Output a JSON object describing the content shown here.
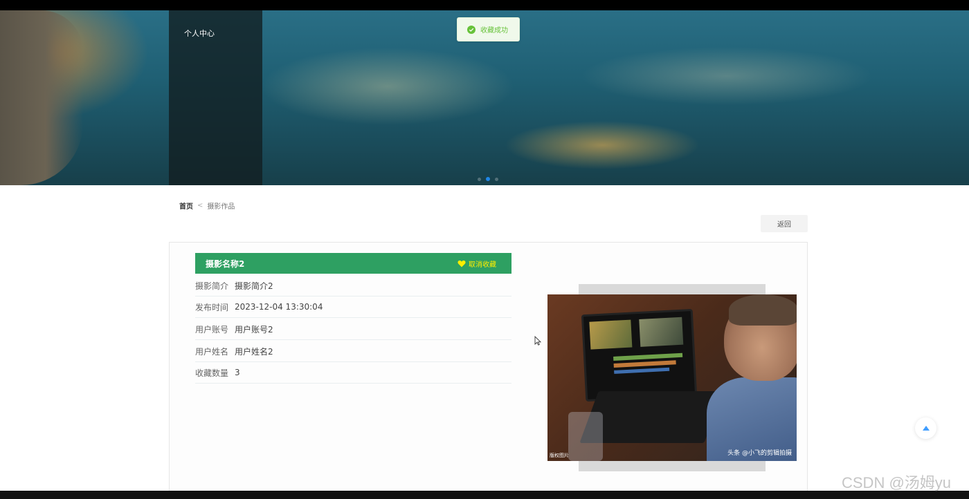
{
  "banner": {
    "side_nav_item": "个人中心",
    "carousel_dots": 3,
    "active_dot": 2
  },
  "toast": {
    "message": "收藏成功",
    "icon": "check-circle-icon"
  },
  "breadcrumb": {
    "home": "首页",
    "separator": "<",
    "current": "摄影作品"
  },
  "actions": {
    "back_label": "返回"
  },
  "detail": {
    "title": "摄影名称2",
    "favorite_label": "取消收藏",
    "fields": [
      {
        "label": "摄影简介",
        "value": "摄影简介2"
      },
      {
        "label": "发布时间",
        "value": "2023-12-04 13:30:04"
      },
      {
        "label": "用户账号",
        "value": "用户账号2"
      },
      {
        "label": "用户姓名",
        "value": "用户姓名2"
      },
      {
        "label": "收藏数量",
        "value": "3"
      }
    ]
  },
  "image": {
    "credit_left": "版权图片",
    "credit_right": "头条 @小飞的剪辑拍摄"
  },
  "watermark": "CSDN @汤姆yu",
  "colors": {
    "title_bar": "#2ea062",
    "favorite": "#ffee00",
    "toast_bg": "#f0f9eb",
    "toast_text": "#67c23a",
    "active_dot": "#1f87e8"
  }
}
